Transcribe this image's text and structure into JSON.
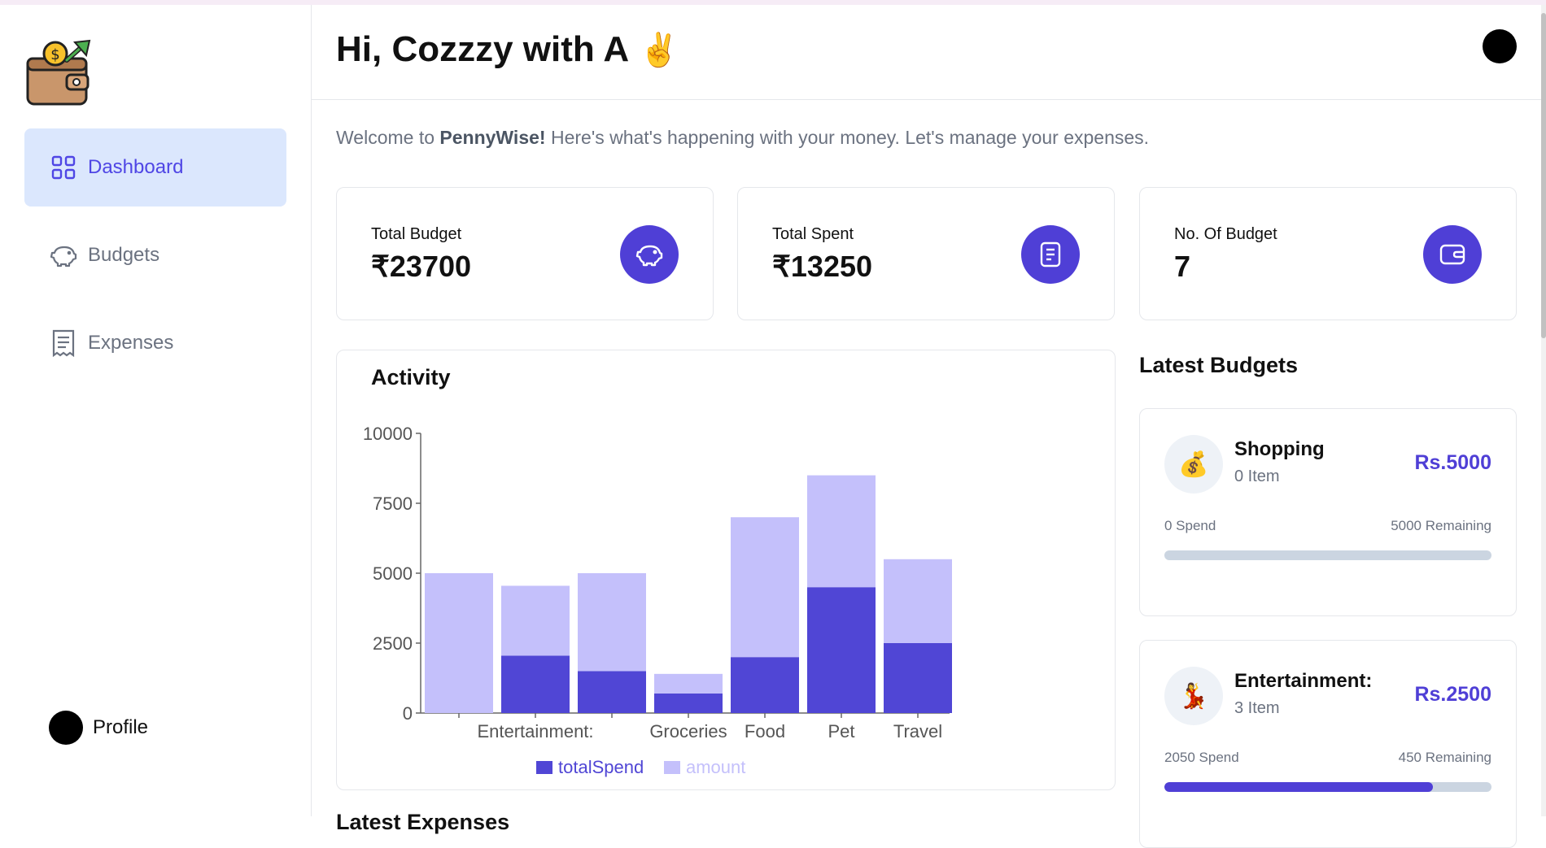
{
  "app": {
    "greeting": "Hi, Cozzzy with A",
    "greeting_emoji": "✌️",
    "welcome_prefix": "Welcome to ",
    "brand": "PennyWise!",
    "welcome_suffix": " Here's what's happening with your money. Let's manage your expenses."
  },
  "sidebar": {
    "items": [
      {
        "label": "Dashboard",
        "icon": "dashboard-grid-icon",
        "active": true
      },
      {
        "label": "Budgets",
        "icon": "piggy-bank-icon",
        "active": false
      },
      {
        "label": "Expenses",
        "icon": "receipt-icon",
        "active": false
      }
    ],
    "profile_label": "Profile"
  },
  "stats": [
    {
      "title": "Total Budget",
      "value": "₹23700",
      "icon": "piggy-bank-icon"
    },
    {
      "title": "Total Spent",
      "value": "₹13250",
      "icon": "receipt-icon"
    },
    {
      "title": "No. Of Budget",
      "value": "7",
      "icon": "wallet-icon"
    }
  ],
  "activity": {
    "title": "Activity"
  },
  "chart_data": {
    "type": "bar",
    "stacked": true,
    "categories": [
      "",
      "Entertainment:",
      "",
      "Groceries",
      "Food",
      "Pet",
      "Travel"
    ],
    "series": [
      {
        "name": "totalSpend",
        "color": "#5046d5",
        "values": [
          0,
          2050,
          1500,
          700,
          2000,
          4500,
          2500
        ]
      },
      {
        "name": "amount",
        "color": "#c4c0fb",
        "values": [
          5000,
          2500,
          3500,
          700,
          5000,
          4000,
          3000
        ]
      }
    ],
    "yticks": [
      "0",
      "2500",
      "5000",
      "7500",
      "10000"
    ],
    "ylim": [
      0,
      10000
    ],
    "legend": "bottom"
  },
  "latest_budgets": {
    "title": "Latest Budgets",
    "items": [
      {
        "emoji": "💰",
        "name": "Shopping",
        "items": "0 Item",
        "amount": "Rs.5000",
        "spend": "0 Spend",
        "remaining": "5000 Remaining",
        "progress": 0
      },
      {
        "emoji": "💃",
        "name": "Entertainment:",
        "items": "3 Item",
        "amount": "Rs.2500",
        "spend": "2050 Spend",
        "remaining": "450 Remaining",
        "progress": 0.82
      }
    ]
  },
  "latest_expenses": {
    "title": "Latest Expenses"
  },
  "colors": {
    "accent": "#4f3fd6",
    "active_bg": "#dbe7fd",
    "bar_light": "#c4c0fb",
    "bar_dark": "#5046d5"
  }
}
